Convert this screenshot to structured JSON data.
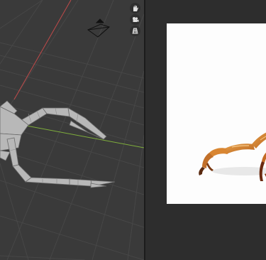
{
  "viewport_3d": {
    "nav_gizmos": [
      {
        "name": "hand-pan-icon",
        "glyph": "✋"
      },
      {
        "name": "camera-icon",
        "glyph": "camera"
      },
      {
        "name": "grid-ortho-icon",
        "glyph": "grid"
      }
    ],
    "axis_colors": {
      "x_axis": "#c04a4a",
      "y_axis": "#7fae3c"
    },
    "grid_color": "#4a4a4a"
  },
  "image_editor": {
    "background": "#fdfdfd",
    "subject": "orange crab leg"
  }
}
